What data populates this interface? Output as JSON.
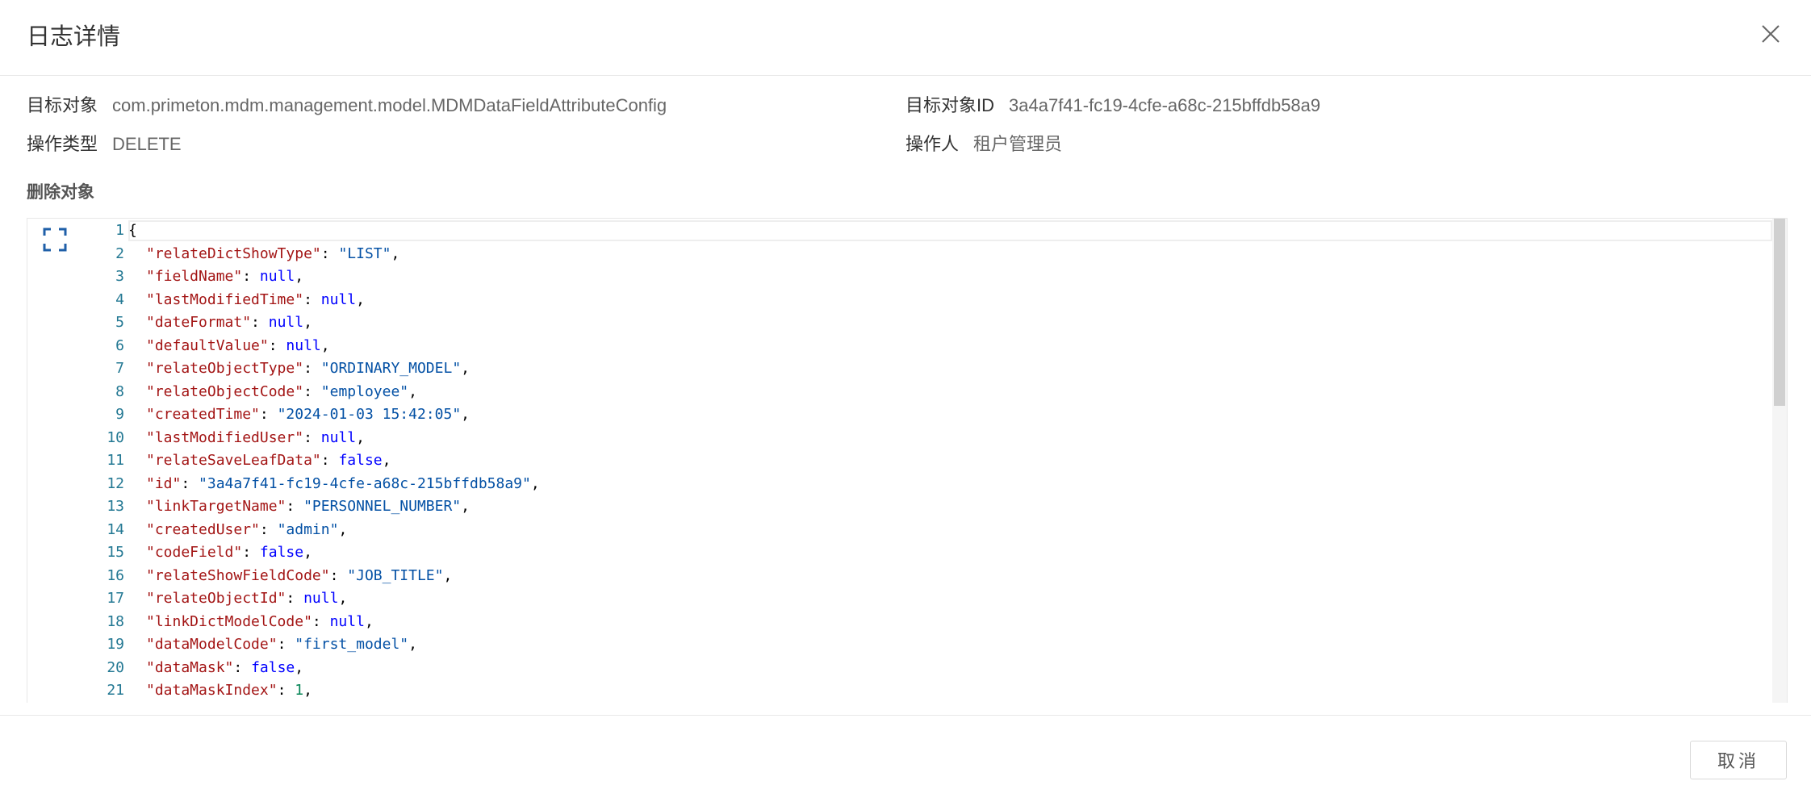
{
  "dialog": {
    "title": "日志详情",
    "close_icon": "close-icon"
  },
  "info": {
    "target_object_label": "目标对象",
    "target_object_value": "com.primeton.mdm.management.model.MDMDataFieldAttributeConfig",
    "target_id_label": "目标对象ID",
    "target_id_value": "3a4a7f41-fc19-4cfe-a68c-215bffdb58a9",
    "operation_type_label": "操作类型",
    "operation_type_value": "DELETE",
    "operator_label": "操作人",
    "operator_value": "租户管理员"
  },
  "section": {
    "title": "删除对象"
  },
  "editor": {
    "expand_icon": "expand-icon",
    "lines": [
      {
        "no": "1",
        "open": "{"
      },
      {
        "no": "2",
        "key": "\"relateDictShowType\"",
        "val": "\"LIST\"",
        "type": "s"
      },
      {
        "no": "3",
        "key": "\"fieldName\"",
        "val": "null",
        "type": "n"
      },
      {
        "no": "4",
        "key": "\"lastModifiedTime\"",
        "val": "null",
        "type": "n"
      },
      {
        "no": "5",
        "key": "\"dateFormat\"",
        "val": "null",
        "type": "n"
      },
      {
        "no": "6",
        "key": "\"defaultValue\"",
        "val": "null",
        "type": "n"
      },
      {
        "no": "7",
        "key": "\"relateObjectType\"",
        "val": "\"ORDINARY_MODEL\"",
        "type": "s"
      },
      {
        "no": "8",
        "key": "\"relateObjectCode\"",
        "val": "\"employee\"",
        "type": "s"
      },
      {
        "no": "9",
        "key": "\"createdTime\"",
        "val": "\"2024-01-03 15:42:05\"",
        "type": "s"
      },
      {
        "no": "10",
        "key": "\"lastModifiedUser\"",
        "val": "null",
        "type": "n"
      },
      {
        "no": "11",
        "key": "\"relateSaveLeafData\"",
        "val": "false",
        "type": "b"
      },
      {
        "no": "12",
        "key": "\"id\"",
        "val": "\"3a4a7f41-fc19-4cfe-a68c-215bffdb58a9\"",
        "type": "s"
      },
      {
        "no": "13",
        "key": "\"linkTargetName\"",
        "val": "\"PERSONNEL_NUMBER\"",
        "type": "s"
      },
      {
        "no": "14",
        "key": "\"createdUser\"",
        "val": "\"admin\"",
        "type": "s"
      },
      {
        "no": "15",
        "key": "\"codeField\"",
        "val": "false",
        "type": "b"
      },
      {
        "no": "16",
        "key": "\"relateShowFieldCode\"",
        "val": "\"JOB_TITLE\"",
        "type": "s"
      },
      {
        "no": "17",
        "key": "\"relateObjectId\"",
        "val": "null",
        "type": "n"
      },
      {
        "no": "18",
        "key": "\"linkDictModelCode\"",
        "val": "null",
        "type": "n"
      },
      {
        "no": "19",
        "key": "\"dataModelCode\"",
        "val": "\"first_model\"",
        "type": "s"
      },
      {
        "no": "20",
        "key": "\"dataMask\"",
        "val": "false",
        "type": "b"
      },
      {
        "no": "21",
        "key": "\"dataMaskIndex\"",
        "val": "1",
        "type": "num"
      }
    ]
  },
  "footer": {
    "cancel_label": "取消"
  }
}
